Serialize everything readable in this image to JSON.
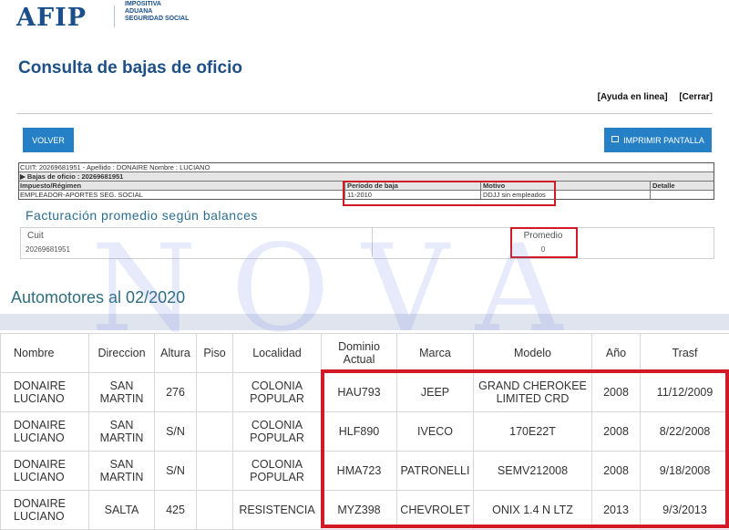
{
  "header": {
    "logo_text": "AFIP",
    "sub_lines": [
      "IMPOSITIVA",
      "ADUANA",
      "SEGURIDAD SOCIAL"
    ],
    "page_title": "Consulta de bajas de oficio",
    "help_link": "[Ayuda en linea]",
    "close_link": "[Cerrar]"
  },
  "buttons": {
    "volver": "VOLVER",
    "print_icon": "printer-icon",
    "print": "IMPRIMIR PANTALLA"
  },
  "info": {
    "id_line": "CUIT: 20269681951 - Apellido : DONAIRE Nombre : LUCIANO",
    "section": "▶ Bajas de oficio : 20269681951",
    "headers": [
      "Impuesto/Régimen",
      "Período de baja",
      "Motivo",
      "Detalle"
    ],
    "row": [
      "EMPLEADOR-APORTES SEG. SOCIAL",
      "11-2010",
      "DDJJ sin empleados",
      ""
    ]
  },
  "facturacion": {
    "title": "Facturación promedio según balances",
    "cuit_label": "Cuit",
    "cuit_value": "20269681951",
    "promedio_label": "Promedio",
    "promedio_value": "0"
  },
  "watermark": "NOVA",
  "automotores": {
    "title": "Automotores al 02/2020",
    "columns": [
      "Nombre",
      "Direccion",
      "Altura",
      "Piso",
      "Localidad",
      "Dominio Actual",
      "Marca",
      "Modelo",
      "Año",
      "Trasf"
    ],
    "rows": [
      [
        "DONAIRE LUCIANO",
        "SAN MARTIN",
        "276",
        "",
        "COLONIA POPULAR",
        "HAU793",
        "JEEP",
        "GRAND CHEROKEE LIMITED CRD",
        "2008",
        "11/12/2009"
      ],
      [
        "DONAIRE LUCIANO",
        "SAN MARTIN",
        "S/N",
        "",
        "COLONIA POPULAR",
        "HLF890",
        "IVECO",
        "170E22T",
        "2008",
        "8/22/2008"
      ],
      [
        "DONAIRE LUCIANO",
        "SAN MARTIN",
        "S/N",
        "",
        "COLONIA POPULAR",
        "HMA723",
        "PATRONELLI",
        "SEMV212008",
        "2008",
        "9/18/2008"
      ],
      [
        "DONAIRE LUCIANO",
        "SALTA",
        "425",
        "",
        "RESISTENCIA",
        "MYZ398",
        "CHEVROLET",
        "ONIX 1.4 N LTZ",
        "2013",
        "9/3/2013"
      ]
    ]
  },
  "colors": {
    "accent_blue": "#2680c5",
    "title_blue": "#1e4f86",
    "highlight_red": "#d21a26"
  }
}
